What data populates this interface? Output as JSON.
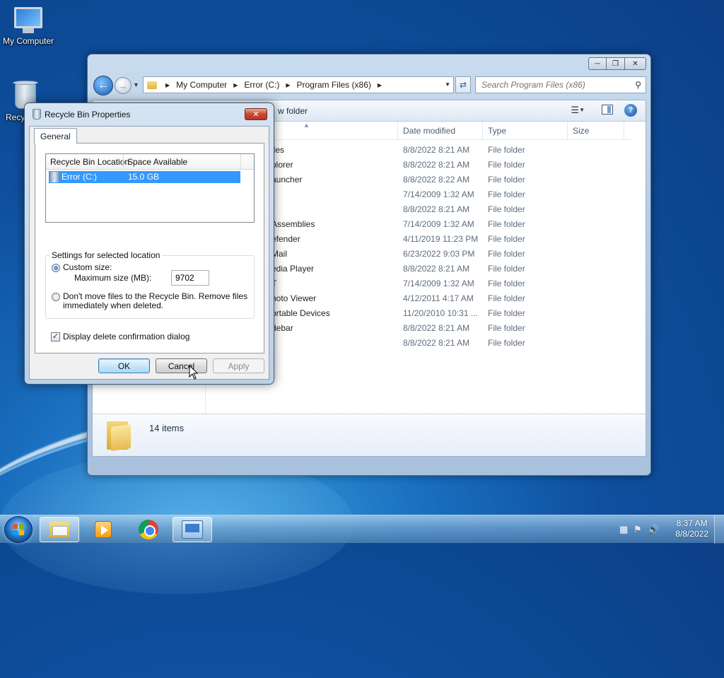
{
  "desktop": {
    "icons": [
      {
        "label": "My Computer"
      },
      {
        "label": "Recy"
      }
    ]
  },
  "explorer": {
    "address": {
      "crumbs": [
        "My Computer",
        "Error (C:)",
        "Program Files (x86)"
      ]
    },
    "search_placeholder": "Search Program Files (x86)",
    "toolbar": {
      "new_folder": "w folder"
    },
    "columns": {
      "date_modified": "Date modified",
      "type": "Type",
      "size": "Size"
    },
    "rows": [
      {
        "name": "iles",
        "date": "8/8/2022 8:21 AM",
        "type": "File folder"
      },
      {
        "name": "plorer",
        "date": "8/8/2022 8:21 AM",
        "type": "File folder"
      },
      {
        "name": "auncher",
        "date": "8/8/2022 8:22 AM",
        "type": "File folder"
      },
      {
        "name": "",
        "date": "7/14/2009 1:32 AM",
        "type": "File folder"
      },
      {
        "name": "",
        "date": "8/8/2022 8:21 AM",
        "type": "File folder"
      },
      {
        "name": "Assemblies",
        "date": "7/14/2009 1:32 AM",
        "type": "File folder"
      },
      {
        "name": "efender",
        "date": "4/11/2019 11:23 PM",
        "type": "File folder"
      },
      {
        "name": "Mail",
        "date": "6/23/2022 9:03 PM",
        "type": "File folder"
      },
      {
        "name": "edia Player",
        "date": "8/8/2022 8:21 AM",
        "type": "File folder"
      },
      {
        "name": "T",
        "date": "7/14/2009 1:32 AM",
        "type": "File folder"
      },
      {
        "name": "hoto Viewer",
        "date": "4/12/2011 4:17 AM",
        "type": "File folder"
      },
      {
        "name": "ortable Devices",
        "date": "11/20/2010 10:31 ...",
        "type": "File folder"
      },
      {
        "name": "debar",
        "date": "8/8/2022 8:21 AM",
        "type": "File folder"
      },
      {
        "name": "",
        "date": "8/8/2022 8:21 AM",
        "type": "File folder"
      }
    ],
    "status": {
      "item_count": "14 items"
    }
  },
  "dialog": {
    "title": "Recycle Bin Properties",
    "tab": "General",
    "list": {
      "col_location": "Recycle Bin Location",
      "col_space": "Space Available",
      "rows": [
        {
          "location": "Error (C:)",
          "space": "15.0 GB"
        }
      ]
    },
    "settings": {
      "group_title": "Settings for selected location",
      "custom_size_label": "Custom size:",
      "max_size_label": "Maximum size (MB):",
      "max_size_value": "9702",
      "dont_move_label_line1": "Don't move files to the Recycle Bin. Remove files",
      "dont_move_label_line2": "immediately when deleted."
    },
    "confirm_label": "Display delete confirmation dialog",
    "buttons": {
      "ok": "OK",
      "cancel": "Cancel",
      "apply": "Apply"
    }
  },
  "taskbar": {
    "clock_time": "8:37 AM",
    "clock_date": "8/8/2022"
  }
}
